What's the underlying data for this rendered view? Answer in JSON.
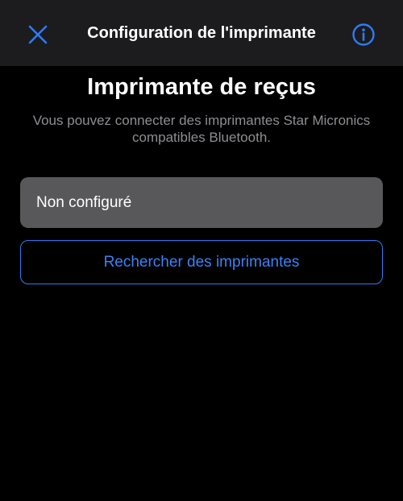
{
  "nav": {
    "title": "Configuration de l'imprimante",
    "close_icon": "close-icon",
    "info_icon": "info-icon"
  },
  "main": {
    "title": "Imprimante de reçus",
    "subtitle": "Vous pouvez connecter des imprimantes Star Micronics compatibles Bluetooth.",
    "status_value": "Non configuré",
    "search_button_label": "Rechercher des imprimantes"
  },
  "colors": {
    "accent": "#2f7bf5",
    "background": "#000000",
    "nav_background": "#1c1c1e",
    "field_background": "#58585a",
    "secondary_text": "#8e8e93"
  }
}
